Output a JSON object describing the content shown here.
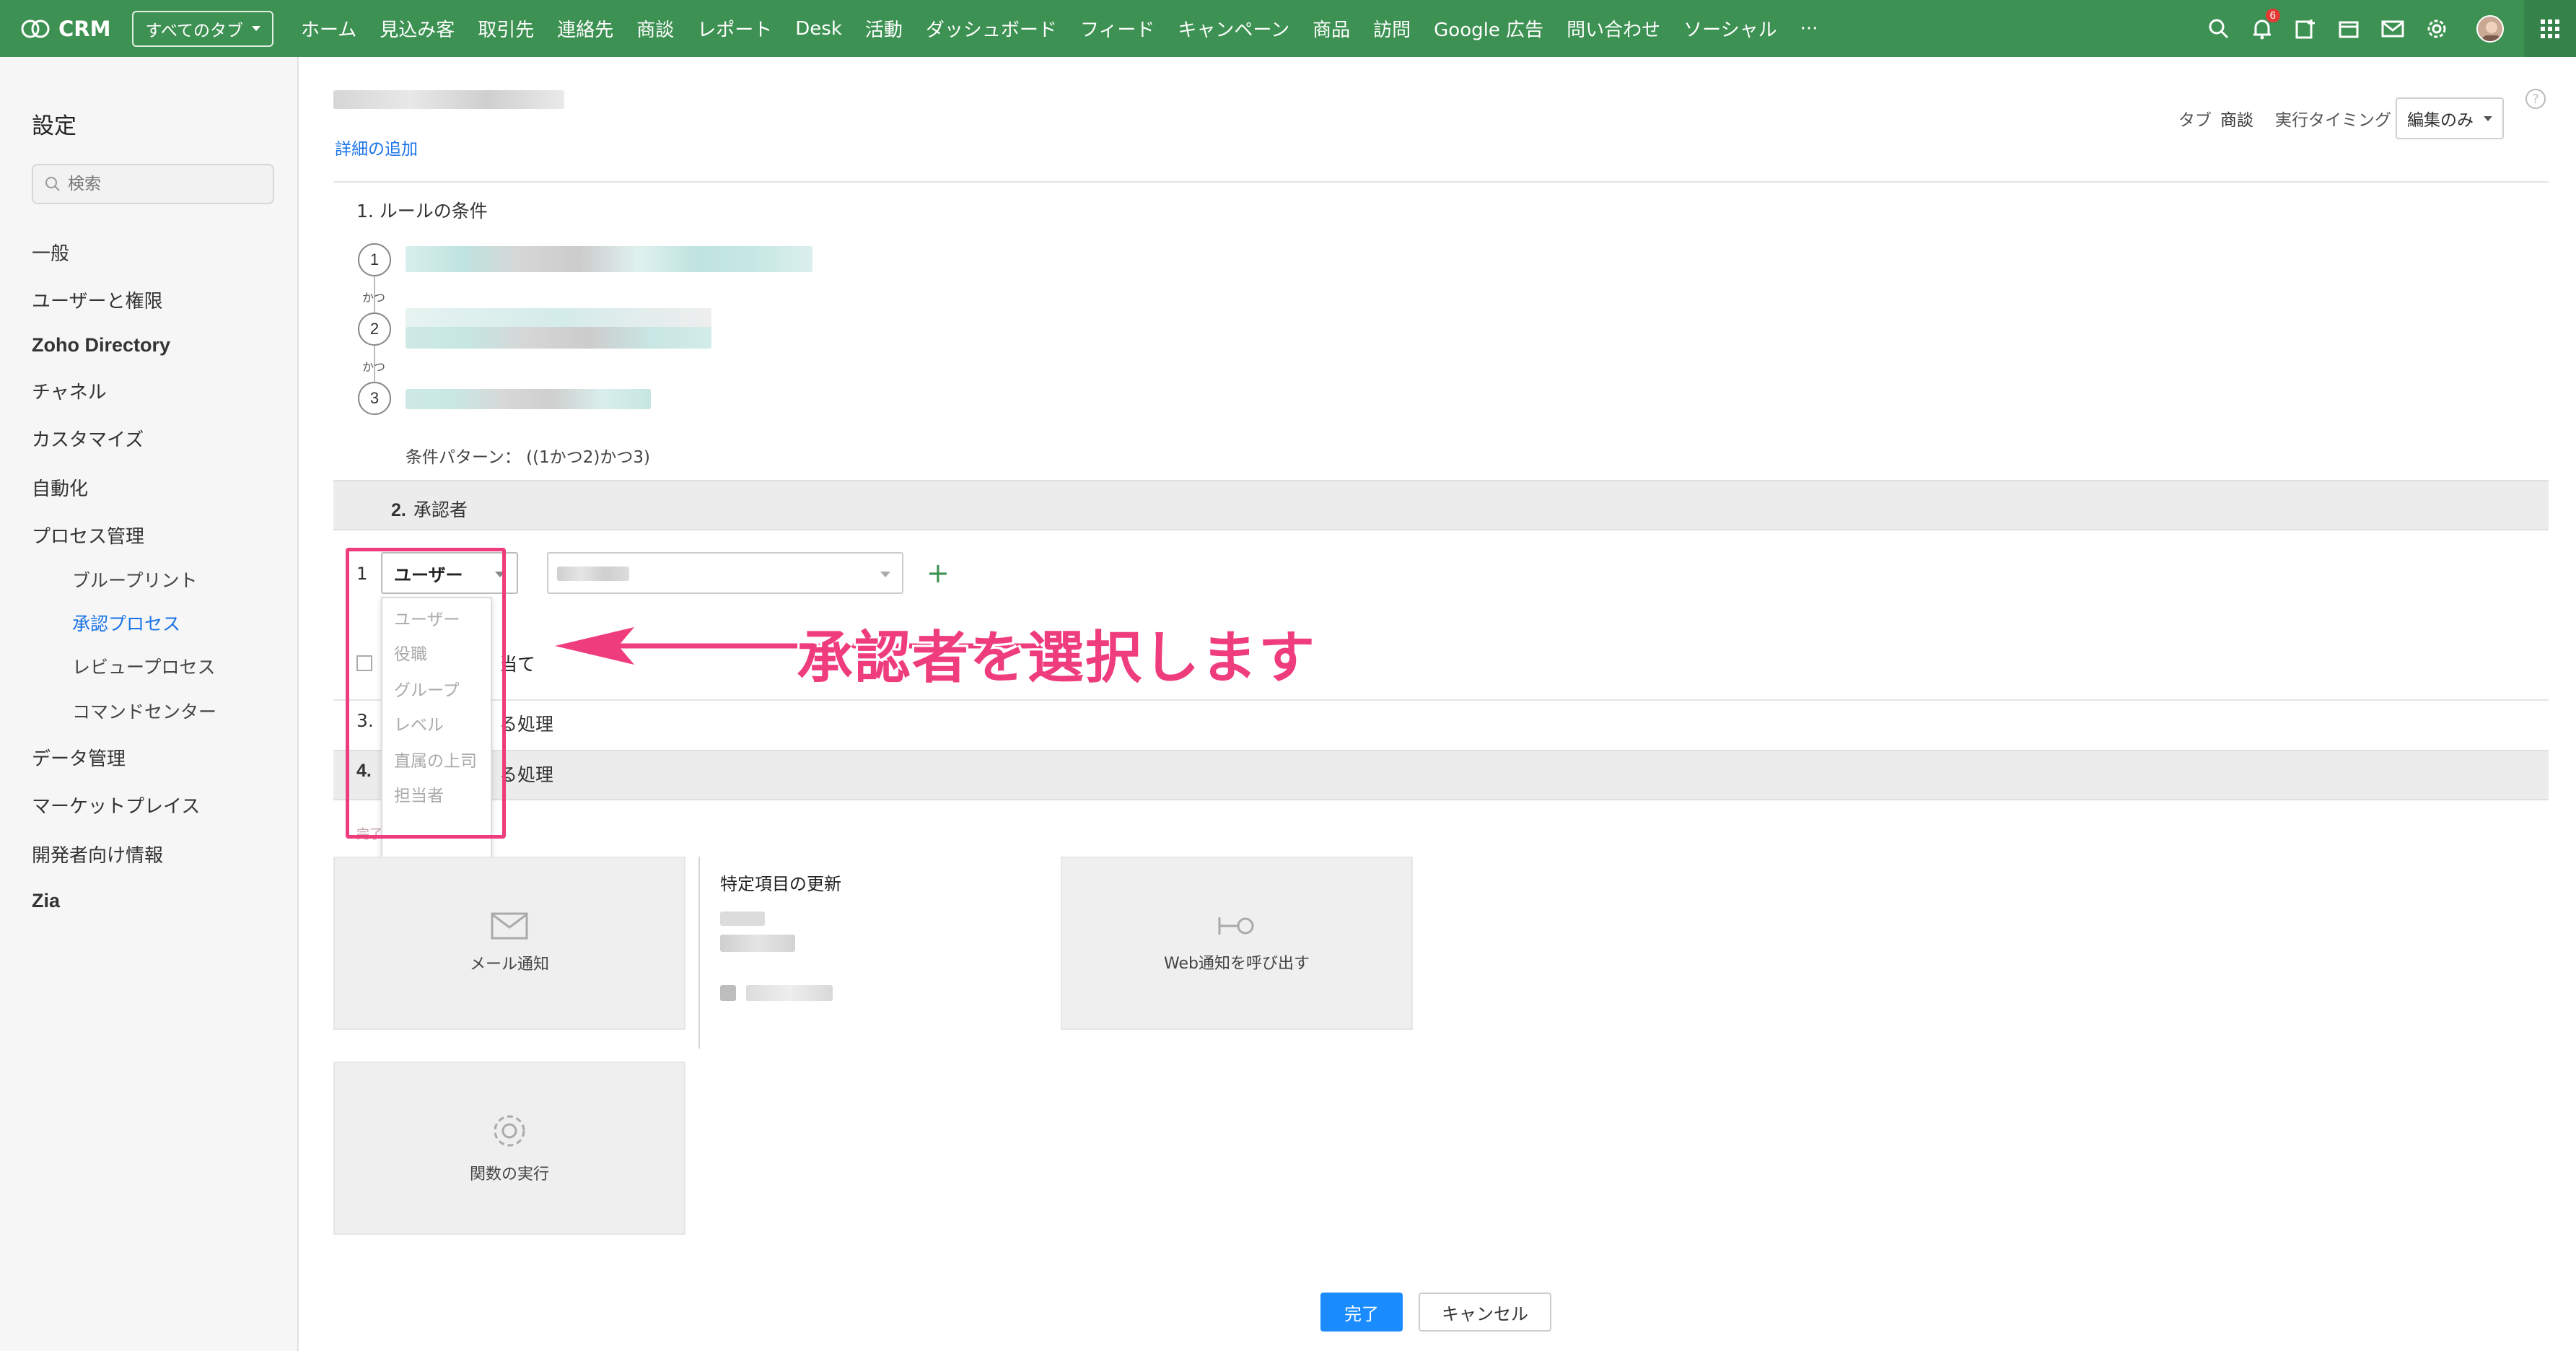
{
  "topbar": {
    "brand": "CRM",
    "all_tabs": "すべてのタブ",
    "nav": [
      "ホーム",
      "見込み客",
      "取引先",
      "連絡先",
      "商談",
      "レポート",
      "Desk",
      "活動",
      "ダッシュボード",
      "フィード",
      "キャンペーン",
      "商品",
      "訪問",
      "Google 広告",
      "問い合わせ",
      "ソーシャル",
      "···"
    ],
    "notification_count": "6",
    "bg_color": "#3d9152"
  },
  "sidebar": {
    "title": "設定",
    "search_placeholder": "検索",
    "items": {
      "general": "一般",
      "users": "ユーザーと権限",
      "zoho_directory": "Zoho Directory",
      "channel": "チャネル",
      "customize": "カスタマイズ",
      "automation": "自動化",
      "process": "プロセス管理",
      "blueprint": "ブループリント",
      "approval": "承認プロセス",
      "review": "レビュープロセス",
      "command": "コマンドセンター",
      "data": "データ管理",
      "marketplace": "マーケットプレイス",
      "developer": "開発者向け情報",
      "zia": "Zia"
    }
  },
  "main": {
    "add_detail": "詳細の追加",
    "meta": {
      "tab_label": "タブ",
      "tab_value": "商談",
      "timing_label": "実行タイミング",
      "timing_value": "編集のみ"
    },
    "help": "?",
    "rule_title": "1.  ルールの条件",
    "conditions": [
      "1",
      "2",
      "3"
    ],
    "and_label": "かつ",
    "pattern": "条件パターン： ((1かつ2)かつ3)",
    "approver_num": "2.",
    "approver_title": "承認者",
    "row_index": "1",
    "approver_type": "ユーザー",
    "approver_options": [
      "ユーザー",
      "役職",
      "グループ",
      "レベル",
      "直属の上司",
      "担当者"
    ],
    "plus": "+",
    "checkbox_label": "当て",
    "sec3": "3.",
    "sec3_tail": "る処理",
    "sec4": "4.",
    "sec4_tail": "る処理",
    "sub_note": "完了後の処理の設定",
    "callout": "承認者を選択します",
    "tiles": {
      "mail": "メール通知",
      "update": "特定項目の更新",
      "webhook": "Web通知を呼び出す",
      "function": "関数の実行"
    },
    "buttons": {
      "done": "完了",
      "cancel": "キャンセル"
    },
    "accent": "#ef3c7c"
  }
}
